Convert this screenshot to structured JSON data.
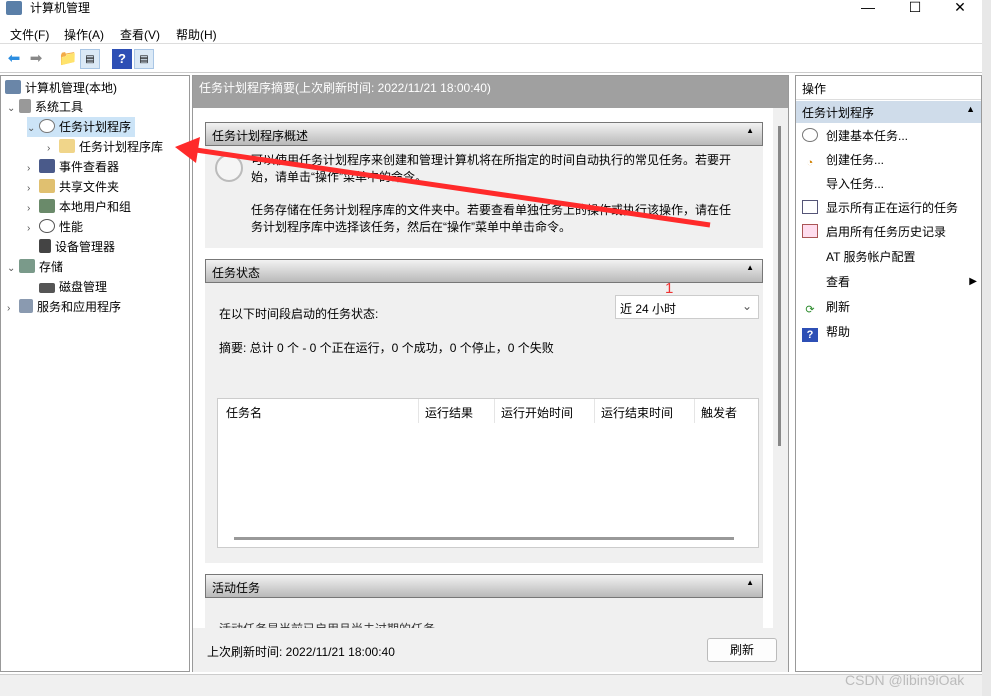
{
  "window": {
    "title": "计算机管理",
    "minimize": "—",
    "maximize": "☐",
    "close": "✕"
  },
  "menu": [
    "文件(F)",
    "操作(A)",
    "查看(V)",
    "帮助(H)"
  ],
  "tree": [
    {
      "label": "计算机管理(本地)"
    },
    {
      "label": "系统工具"
    },
    {
      "label": "任务计划程序"
    },
    {
      "label": "任务计划程序库"
    },
    {
      "label": "事件查看器"
    },
    {
      "label": "共享文件夹"
    },
    {
      "label": "本地用户和组"
    },
    {
      "label": "性能"
    },
    {
      "label": "设备管理器"
    },
    {
      "label": "存储"
    },
    {
      "label": "磁盘管理"
    },
    {
      "label": "服务和应用程序"
    }
  ],
  "center": {
    "header": "任务计划程序摘要(上次刷新时间: 2022/11/21 18:00:40)",
    "overview": {
      "title": "任务计划程序概述",
      "p1": "可以使用任务计划程序来创建和管理计算机将在所指定的时间自动执行的常见任务。若要开始，请单击“操作”菜单中的命令。",
      "p2": "任务存储在任务计划程序库的文件夹中。若要查看单独任务上的操作或执行该操作，请在任务计划程序库中选择该任务，然后在“操作”菜单中单击命令。"
    },
    "status": {
      "title": "任务状态",
      "label": "在以下时间段启动的任务状态:",
      "period": "近 24 小时",
      "summary": "摘要: 总计 0 个 - 0 个正在运行，0 个成功，0 个停止，0 个失败",
      "columns": [
        "任务名",
        "运行结果",
        "运行开始时间",
        "运行结束时间",
        "触发者"
      ]
    },
    "active": {
      "title": "活动任务",
      "text": "活动任务是当前已启用且尚未过期的任务。"
    },
    "footer": {
      "last_refresh": "上次刷新时间: 2022/11/21 18:00:40",
      "refresh": "刷新"
    }
  },
  "actions": {
    "title": "操作",
    "group": "任务计划程序",
    "items": [
      "创建基本任务...",
      "创建任务...",
      "导入任务...",
      "显示所有正在运行的任务",
      "启用所有任务历史记录",
      "AT 服务帐户配置",
      "查看",
      "刷新",
      "帮助"
    ]
  },
  "annotation": "1",
  "watermark": "CSDN @libin9iOak",
  "colors": {
    "arrow": "#ff2a2a",
    "selected": "#cce4f7",
    "header": "#a0a0a0"
  }
}
